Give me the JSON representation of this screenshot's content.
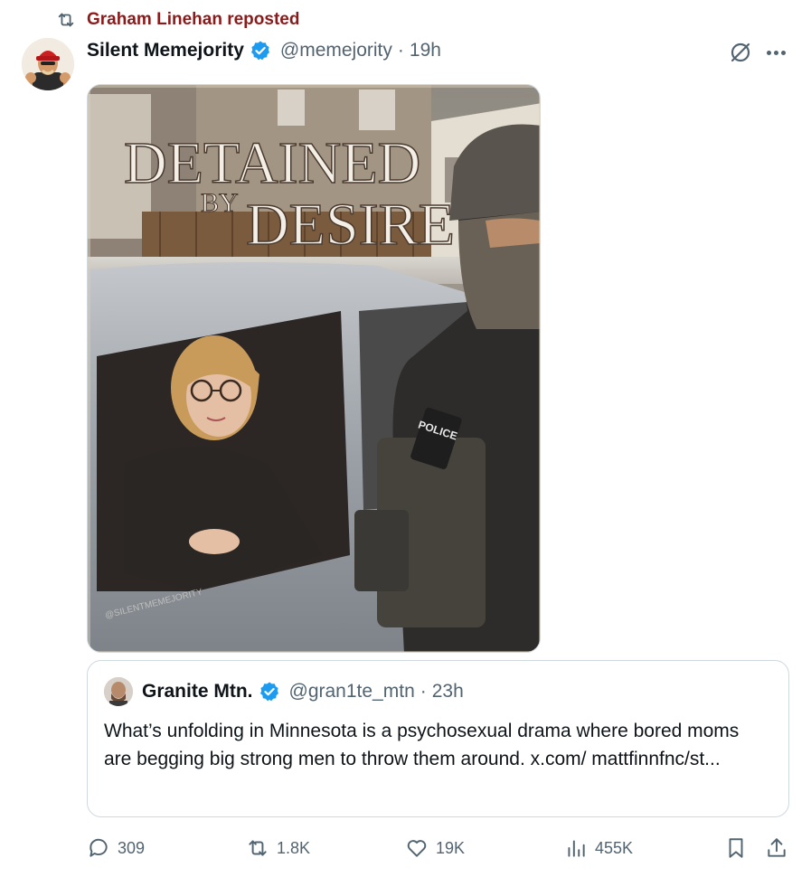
{
  "repost": {
    "label": "Graham Linehan reposted",
    "icon": "repost-icon",
    "color": "#8b1a1a"
  },
  "post": {
    "display_name": "Silent Memejority",
    "handle": "@memejority",
    "separator": "·",
    "time": "19h",
    "verified_icon": "verified-badge-icon",
    "grok_icon": "grok-icon",
    "more_icon": "more-icon"
  },
  "poster": {
    "title_line1": "DETAINED",
    "title_line2": "BY",
    "title_line3": "DESIRE",
    "vest_patch": "POLICE",
    "watermark": "@SILENTMEMEJORITY"
  },
  "quote": {
    "display_name": "Granite Mtn.",
    "handle": "@gran1te_mtn",
    "separator": "·",
    "time": "23h",
    "text": "What’s unfolding in Minnesota is a psychosexual drama where bored moms are begging big strong men to throw them around. x.com/ mattfinnfnc/st..."
  },
  "actions": {
    "replies": "309",
    "reposts": "1.8K",
    "likes": "19K",
    "views": "455K"
  },
  "colors": {
    "accent": "#1d9bf0",
    "muted": "#536471",
    "text": "#0f1419",
    "border": "#cfd9de"
  }
}
